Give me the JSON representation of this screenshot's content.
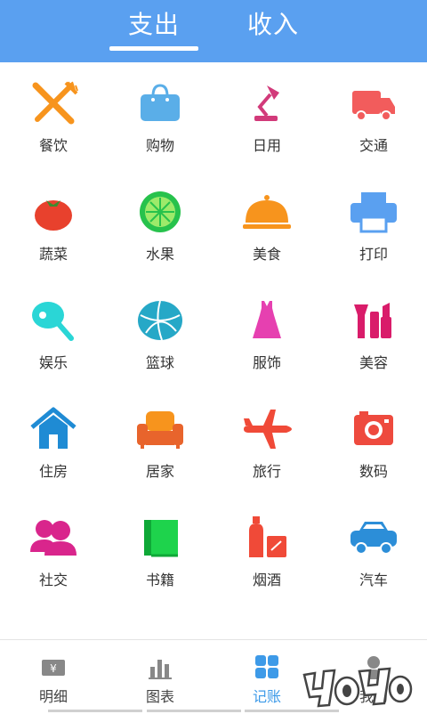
{
  "tabs": [
    {
      "label": "支出",
      "active": true
    },
    {
      "label": "收入",
      "active": false
    }
  ],
  "categories": [
    {
      "label": "餐饮",
      "icon": "fork-knife-icon"
    },
    {
      "label": "购物",
      "icon": "shopping-bag-icon"
    },
    {
      "label": "日用",
      "icon": "desk-lamp-icon"
    },
    {
      "label": "交通",
      "icon": "truck-icon"
    },
    {
      "label": "蔬菜",
      "icon": "tomato-icon"
    },
    {
      "label": "水果",
      "icon": "lime-icon"
    },
    {
      "label": "美食",
      "icon": "food-cloche-icon"
    },
    {
      "label": "打印",
      "icon": "printer-icon"
    },
    {
      "label": "娱乐",
      "icon": "ping-pong-icon"
    },
    {
      "label": "篮球",
      "icon": "basketball-icon"
    },
    {
      "label": "服饰",
      "icon": "dress-icon"
    },
    {
      "label": "美容",
      "icon": "makeup-icon"
    },
    {
      "label": "住房",
      "icon": "house-icon"
    },
    {
      "label": "居家",
      "icon": "sofa-icon"
    },
    {
      "label": "旅行",
      "icon": "airplane-icon"
    },
    {
      "label": "数码",
      "icon": "camera-icon"
    },
    {
      "label": "社交",
      "icon": "people-icon"
    },
    {
      "label": "书籍",
      "icon": "book-icon"
    },
    {
      "label": "烟酒",
      "icon": "bottles-icon"
    },
    {
      "label": "汽车",
      "icon": "car-icon"
    }
  ],
  "nav": [
    {
      "label": "明细",
      "icon": "ledger-icon",
      "active": false
    },
    {
      "label": "图表",
      "icon": "bar-chart-icon",
      "active": false
    },
    {
      "label": "记账",
      "icon": "grid-icon",
      "active": true
    },
    {
      "label": "我的",
      "icon": "user-icon",
      "active": false
    }
  ],
  "colors": {
    "header": "#5aa0f0",
    "active_nav": "#3d9ae8"
  }
}
